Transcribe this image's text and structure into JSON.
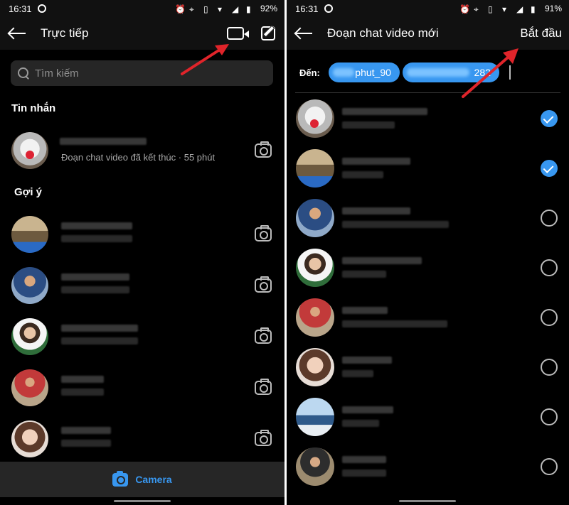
{
  "left_screen": {
    "status": {
      "time": "16:31",
      "battery": "92%"
    },
    "header": {
      "title": "Trực tiếp",
      "video_icon": "video-camera-icon",
      "compose_icon": "edit-icon"
    },
    "search": {
      "placeholder": "Tìm kiếm"
    },
    "messages_section": "Tin nhắn",
    "message_row": {
      "subtitle": "Đoạn chat video đã kết thúc · 55 phút"
    },
    "suggestions_section": "Gợi ý",
    "bottom_bar": {
      "label": "Camera",
      "icon": "camera-icon"
    }
  },
  "right_screen": {
    "status": {
      "time": "16:31",
      "battery": "91%"
    },
    "header": {
      "title": "Đoạn chat video mới",
      "start_label": "Bắt đầu"
    },
    "to": {
      "label": "Đến:",
      "chips": [
        "phut_90",
        "282"
      ]
    },
    "contacts": [
      {
        "selected": true
      },
      {
        "selected": true
      },
      {
        "selected": false
      },
      {
        "selected": false
      },
      {
        "selected": false
      },
      {
        "selected": false
      },
      {
        "selected": false
      },
      {
        "selected": false
      }
    ]
  },
  "colors": {
    "accent": "#3897f0",
    "arrow": "#e0242a",
    "background": "#000000"
  }
}
